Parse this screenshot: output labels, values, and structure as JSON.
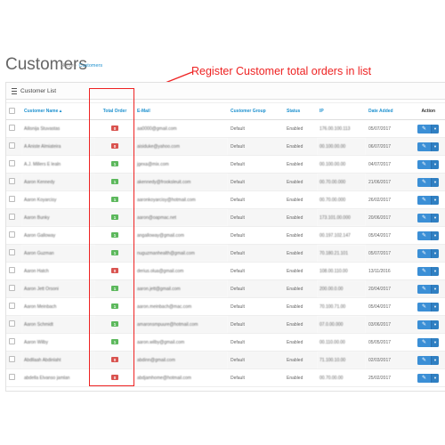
{
  "page": {
    "title": "Customers",
    "breadcrumb": [
      "Home",
      "Customers"
    ]
  },
  "annotation": {
    "text": "Register Customer total orders in list",
    "color": "#e22222"
  },
  "panel": {
    "heading": "Customer List"
  },
  "colors": {
    "accent": "#1e91cf",
    "badge_green": "#5cb85c",
    "badge_red": "#d9534f",
    "button_primary": "#3b8fd6"
  },
  "table": {
    "columns": {
      "customer_name": "Customer Name ▴",
      "total_order": "Total Order",
      "email": "E-Mail",
      "customer_group": "Customer Group",
      "status": "Status",
      "ip": "IP",
      "date_added": "Date Added",
      "action": "Action"
    },
    "rows": [
      {
        "name": "Ailisnija Stuvastas",
        "orders": "0",
        "orders_status": "zero",
        "email": "aa0000@gmail.com",
        "group": "Default",
        "status": "Enabled",
        "ip": "176.00.100.113",
        "date": "05/07/2017"
      },
      {
        "name": "A Aniste Almiateira",
        "orders": "0",
        "orders_status": "zero",
        "email": "aisiduke@yahoo.com",
        "group": "Default",
        "status": "Enabled",
        "ip": "00.100.00.00",
        "date": "06/07/2017"
      },
      {
        "name": "A.J. Millers E lealn",
        "orders": "1",
        "orders_status": "positive",
        "email": "jgexa@mix.com",
        "group": "Default",
        "status": "Enabled",
        "ip": "00.100.00.00",
        "date": "04/07/2017"
      },
      {
        "name": "Aaron Kennedy",
        "orders": "1",
        "orders_status": "positive",
        "email": "akennedy@frooksleuit.com",
        "group": "Default",
        "status": "Enabled",
        "ip": "00.70.00.000",
        "date": "21/06/2017"
      },
      {
        "name": "Aaron Koyarcisy",
        "orders": "1",
        "orders_status": "positive",
        "email": "aaronkoyarcisy@hotmail.com",
        "group": "Default",
        "status": "Enabled",
        "ip": "00.70.00.000",
        "date": "26/02/2017"
      },
      {
        "name": "Aaron Bunky",
        "orders": "1",
        "orders_status": "positive",
        "email": "aaron@oapmac.net",
        "group": "Default",
        "status": "Enabled",
        "ip": "173.101.00.000",
        "date": "20/06/2017"
      },
      {
        "name": "Aaron Galloway",
        "orders": "1",
        "orders_status": "positive",
        "email": "angalloway@gmail.com",
        "group": "Default",
        "status": "Enabled",
        "ip": "00.197.102.147",
        "date": "05/04/2017"
      },
      {
        "name": "Aaron Guzman",
        "orders": "1",
        "orders_status": "positive",
        "email": "nuguzmanhealth@gmail.com",
        "group": "Default",
        "status": "Enabled",
        "ip": "70.180.21.101",
        "date": "05/07/2017"
      },
      {
        "name": "Aaron Hatch",
        "orders": "0",
        "orders_status": "zero",
        "email": "derius.olua@gmail.com",
        "group": "Default",
        "status": "Enabled",
        "ip": "108.00.110.00",
        "date": "13/11/2016"
      },
      {
        "name": "Aaron Jett Orsoni",
        "orders": "1",
        "orders_status": "positive",
        "email": "aaron.jett@gmail.com",
        "group": "Default",
        "status": "Enabled",
        "ip": "200.00.0.00",
        "date": "20/04/2017"
      },
      {
        "name": "Aaron Meinbach",
        "orders": "1",
        "orders_status": "positive",
        "email": "aaron.meinbach@mac.com",
        "group": "Default",
        "status": "Enabled",
        "ip": "70.100.71.00",
        "date": "05/04/2017"
      },
      {
        "name": "Aaron Schmidt",
        "orders": "1",
        "orders_status": "positive",
        "email": "amaronsmpuure@hotmail.com",
        "group": "Default",
        "status": "Enabled",
        "ip": "07.0.00.000",
        "date": "03/06/2017"
      },
      {
        "name": "Aaron Wilby",
        "orders": "1",
        "orders_status": "positive",
        "email": "aaron.wilby@gmail.com",
        "group": "Default",
        "status": "Enabled",
        "ip": "00.110.00.00",
        "date": "05/05/2017"
      },
      {
        "name": "Abdllaah Abdinlaht",
        "orders": "0",
        "orders_status": "zero",
        "email": "abdinn@gmail.com",
        "group": "Default",
        "status": "Enabled",
        "ip": "71.100.10.00",
        "date": "02/03/2017"
      },
      {
        "name": "abdella Elvanso jamlan",
        "orders": "0",
        "orders_status": "zero",
        "email": "abdjamhome@hotmail.com",
        "group": "Default",
        "status": "Enabled",
        "ip": "00.70.00.00",
        "date": "25/02/2017"
      }
    ]
  }
}
